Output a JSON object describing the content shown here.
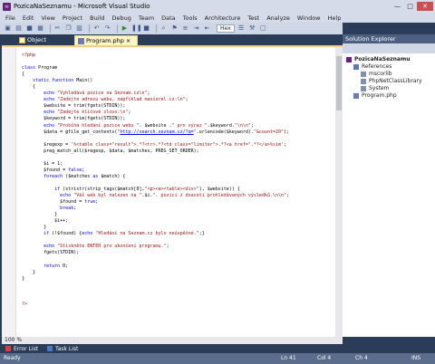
{
  "window": {
    "title": "PozicaNaSeznamu - Microsoft Visual Studio",
    "min_label": "—",
    "max_label": "□",
    "close_label": "✕"
  },
  "menu": [
    "File",
    "Edit",
    "View",
    "Project",
    "Build",
    "Debug",
    "Team",
    "Data",
    "Tools",
    "Architecture",
    "Test",
    "Analyze",
    "Window",
    "Help"
  ],
  "toolbar": {
    "config": "Hex"
  },
  "tabs": {
    "object_browser": "Object Browser",
    "program": "Program.php ×"
  },
  "code_lines": [
    "<?php",
    "",
    "class Program",
    "{",
    "    static function Main()",
    "    {",
    "        echo \"Vyhledává pozice na Seznam.cz\\n\";",
    "        echo \"Zadejte adresu webu, například masíorel.cz:\\n\";",
    "        $website = trim(fgets(STDIN));",
    "        echo \"Zadejte klíčové slovo:\\n\";",
    "        $keyword = trim(fgets(STDIN));",
    "        echo \"Probíhá hledání pozice webu \". $website .\" pro výraz \".$keyword.\"\\n\\n\";",
    "        $data = @file_get_contents(\"http://search.seznam.cz/?q=\".urlencode($keyword).\"&count=20\");",
    "",
    "        $regexp = '%<table class=\"result\">.*?<tr>.*?<td class=\"limiter\">.*?<a href=\".*?</a>%sim';",
    "        preg_match_all($regexp, $data, $matches, PREG_SET_ORDER);",
    "",
    "        $i = 1;",
    "        $found = false;",
    "        foreach ($matches as $match) {",
    "",
    "            if (stristr(strip_tags($match[0],\"<p><a><table><div>\"), $website)) {",
    "              echo \"Váš web byl nalezen na \".$i.\". pozici z dvaceti prohledávaných výsledků.\\n\\n\";",
    "              $found = true;",
    "              break;",
    "            }",
    "            $i++;",
    "        }",
    "        if (!$found) {echo \"Hledání na Seznam.cz bylo neúspěšné.\";}",
    "",
    "        echo \"Stiskněte ENTER pro ukončení programu.\";",
    "        fgets(STDIN);",
    "",
    "        return 0;",
    "    }",
    "}",
    "",
    "",
    "",
    "?>"
  ],
  "zoom": "100 %",
  "solution_explorer": {
    "title": "Solution Explorer",
    "items": [
      {
        "label": "PozicaNaSeznamu",
        "indent": 0,
        "icon": "project-icon",
        "bold": true
      },
      {
        "label": "References",
        "indent": 1,
        "icon": "references-icon"
      },
      {
        "label": "mscorlib",
        "indent": 2,
        "icon": "reference-icon"
      },
      {
        "label": "PhpNetClassLibrary",
        "indent": 2,
        "icon": "reference-icon"
      },
      {
        "label": "System",
        "indent": 2,
        "icon": "reference-icon"
      },
      {
        "label": "Program.php",
        "indent": 1,
        "icon": "php-file-icon"
      }
    ]
  },
  "bottom_tabs": [
    "Error List",
    "Task List"
  ],
  "status": {
    "ready": "Ready",
    "line": "Ln 41",
    "col": "Col 4",
    "ch": "Ch 4",
    "mode": "INS"
  },
  "colors": {
    "accent": "#2b3c59",
    "active_tab": "#fbf4c7",
    "keyword": "#0000ff",
    "string": "#a31515",
    "status": "#5a6d8c"
  }
}
